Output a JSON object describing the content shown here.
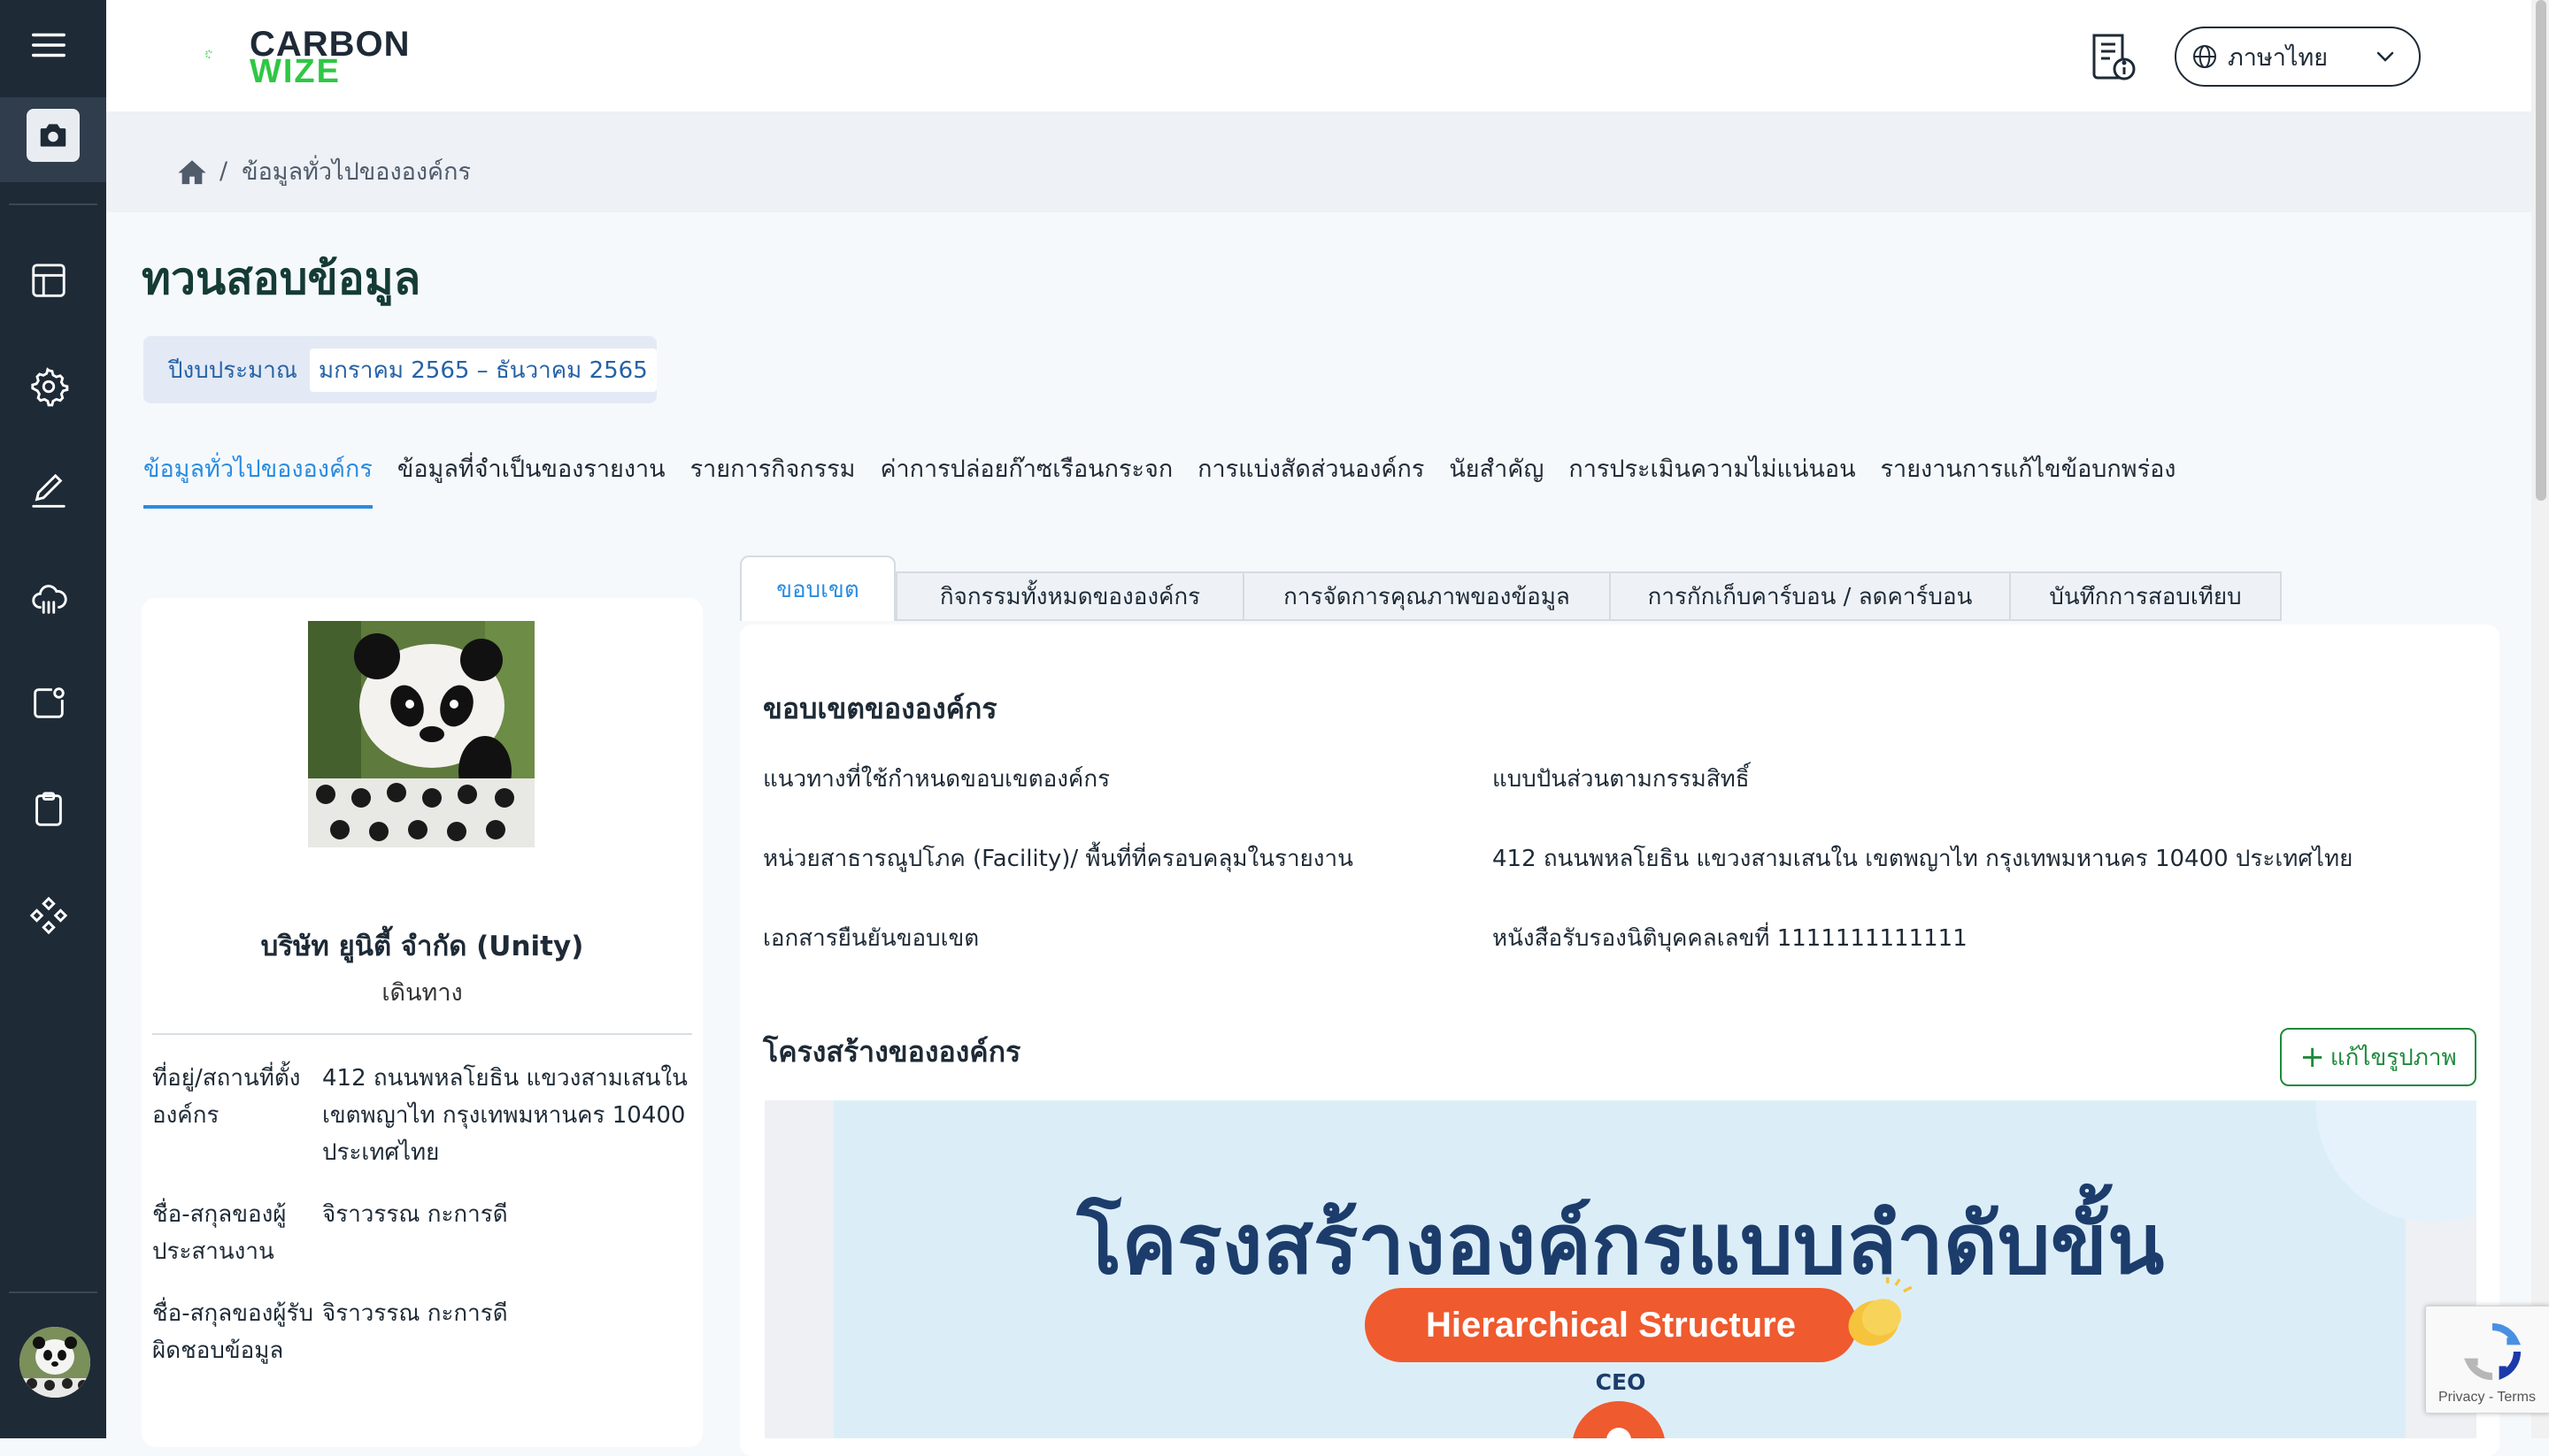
{
  "app": {
    "logo_line1": "CARBON",
    "logo_line2": "WIZE",
    "language": "ภาษาไทย"
  },
  "sidebar": {
    "items": [
      {
        "icon": "camera-icon"
      },
      {
        "icon": "layout-icon"
      },
      {
        "icon": "gear-icon"
      },
      {
        "icon": "pencil-icon"
      },
      {
        "icon": "cloud-icon"
      },
      {
        "icon": "notification-square-icon"
      },
      {
        "icon": "clipboard-icon"
      },
      {
        "icon": "components-icon"
      }
    ]
  },
  "breadcrumb": {
    "separator": "/",
    "current": "ข้อมูลทั่วไปขององค์กร"
  },
  "page": {
    "title": "ทวนสอบข้อมูล",
    "budget_label": "ปีงบประมาณ",
    "budget_value": "มกราคม 2565 – ธันวาคม 2565"
  },
  "tabs": [
    {
      "label": "ข้อมูลทั่วไปขององค์กร",
      "active": true
    },
    {
      "label": "ข้อมูลที่จำเป็นของรายงาน"
    },
    {
      "label": "รายการกิจกรรม"
    },
    {
      "label": "ค่าการปล่อยก๊าซเรือนกระจก"
    },
    {
      "label": "การแบ่งสัดส่วนองค์กร"
    },
    {
      "label": "นัยสำคัญ"
    },
    {
      "label": "การประเมินความไม่แน่นอน"
    },
    {
      "label": "รายงานการแก้ไขข้อบกพร่อง"
    }
  ],
  "profile": {
    "company_name": "บริษัท ยูนิตี้ จำกัด (Unity)",
    "subtitle": "เดินทาง",
    "rows": [
      {
        "label": "ที่อยู่/สถานที่ตั้งองค์กร",
        "value": "412 ถนนพหลโยธิน แขวงสามเสนใน เขตพญาไท กรุงเทพมหานคร 10400 ประเทศไทย"
      },
      {
        "label": "ชื่อ-สกุลของผู้ประสานงาน",
        "value": "จิราวรรณ กะการดี"
      },
      {
        "label": "ชื่อ-สกุลของผู้รับผิดชอบข้อมูล",
        "value": "จิราวรรณ กะการดี"
      }
    ]
  },
  "subtabs": [
    {
      "label": "ขอบเขต",
      "active": true
    },
    {
      "label": "กิจกรรมทั้งหมดขององค์กร"
    },
    {
      "label": "การจัดการคุณภาพของข้อมูล"
    },
    {
      "label": "การกักเก็บคาร์บอน / ลดคาร์บอน"
    },
    {
      "label": "บันทึกการสอบเทียบ"
    }
  ],
  "scope": {
    "title": "ขอบเขตขององค์กร",
    "items": [
      {
        "label": "แนวทางที่ใช้กำหนดขอบเขตองค์กร",
        "value": "แบบปันส่วนตามกรรมสิทธิ์"
      },
      {
        "label": "หน่วยสาธารณูปโภค (Facility)/ พื้นที่ที่ครอบคลุมในรายงาน",
        "value": "412 ถนนพหลโยธิน แขวงสามเสนใน เขตพญาไท กรุงเทพมหานคร 10400 ประเทศไทย"
      },
      {
        "label": "เอกสารยืนยันขอบเขต",
        "value": "หนังสือรับรองนิติบุคคลเลขที่ 1111111111111"
      }
    ]
  },
  "structure": {
    "title": "โครงสร้างขององค์กร",
    "edit_label": "แก้ไขรูปภาพ",
    "image": {
      "heading": "โครงสร้างองค์กรแบบลำดับขั้น",
      "pill": "Hierarchical Structure",
      "ceo": "CEO"
    }
  },
  "recaptcha": {
    "terms": "Privacy - Terms"
  },
  "colors": {
    "sidebar": "#1e2a36",
    "accent": "#2a8ce0",
    "brand_green": "#2fc744",
    "edit_green": "#1e8a3c",
    "org_orange": "#ef5a2e"
  }
}
